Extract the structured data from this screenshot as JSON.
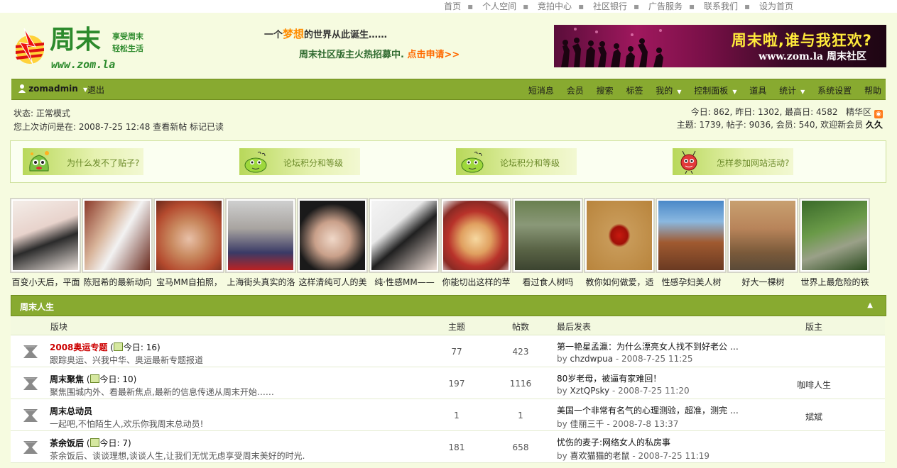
{
  "top_links": [
    "首页",
    "个人空间",
    "竞拍中心",
    "社区银行",
    "广告服务",
    "联系我们",
    "设为首页"
  ],
  "logo": {
    "brand": "周末",
    "tag1": "享受周末",
    "tag2": "轻松生活",
    "url": "www.zom.la"
  },
  "slogan": {
    "line1_pre": "一个",
    "line1_em": "梦想",
    "line1_post": "的世界从此诞生……",
    "line2": "周末社区版主火热招募中.",
    "line2_link": "点击申请>>"
  },
  "banner": {
    "title": "周末啦,谁与我狂欢?",
    "subtitle": "www.zom.la 周末社区"
  },
  "nav": {
    "user": "zomadmin",
    "logout": "退出",
    "items": [
      "短消息",
      "会员",
      "搜索",
      "标签",
      "我的",
      "控制面板",
      "道具",
      "统计",
      "系统设置",
      "帮助"
    ]
  },
  "status": {
    "mode_label": "状态:",
    "mode": "正常模式",
    "last_visit": "您上次访问是在: 2008-7-25 12:48",
    "view_new": "查看新帖",
    "mark_read": "标记已读"
  },
  "stats": {
    "line1": "今日: 862, 昨日: 1302, 最高日: 4582",
    "digest": "精华区",
    "line2": "主题: 1739, 帖子: 9036, 会员: 540, 欢迎新会员",
    "newest": "久久"
  },
  "tips": [
    "为什么发不了贴子?",
    "论坛积分和等级",
    "论坛积分和等级",
    "怎样参加网站活动?"
  ],
  "photos": [
    {
      "caption": "百变小天后，平面"
    },
    {
      "caption": "陈冠希的最新动向"
    },
    {
      "caption": "宝马MM自拍照，"
    },
    {
      "caption": "上海街头真实的洛"
    },
    {
      "caption": "这样清纯可人的美"
    },
    {
      "caption": "纯·性感MM——"
    },
    {
      "caption": "你能切出这样的苹"
    },
    {
      "caption": "看过食人树吗"
    },
    {
      "caption": "教你如何做爱，适"
    },
    {
      "caption": "性感孕妇美人树"
    },
    {
      "caption": "好大一棵树"
    },
    {
      "caption": "世界上最危险的铁"
    }
  ],
  "category": {
    "title": "周末人生",
    "collapse": "▲"
  },
  "columns": {
    "forum": "版块",
    "topics": "主题",
    "posts": "帖数",
    "last": "最后发表",
    "moderator": "版主"
  },
  "forums": [
    {
      "name": "2008奥运专题",
      "today": "今日: 16",
      "desc": "跟踪奥运、兴我中华、奥运最新专题报道",
      "topics": "77",
      "posts": "423",
      "last_title": "第一艳星孟瀛：为什么漂亮女人找不到好老公 …",
      "by": "by",
      "last_author": "chzdwpua",
      "last_time": "- 2008-7-25 11:25",
      "moderator": ""
    },
    {
      "name": "周末聚焦",
      "today": "今日: 10",
      "desc": "聚焦围城内外、看最新焦点,最新的信息传递从周末开始……",
      "topics": "197",
      "posts": "1116",
      "last_title": "80岁老母，被逼有家难回！",
      "by": "by",
      "last_author": "XztQPsky",
      "last_time": "- 2008-7-25 11:20",
      "moderator": "咖啡人生"
    },
    {
      "name": "周末总动员",
      "today": "",
      "desc": "一起吧,不怕陌生人,欢乐你我周末总动员!",
      "topics": "1",
      "posts": "1",
      "last_title": "美国一个非常有名气的心理测验，超准，测完 …",
      "by": "by",
      "last_author": "佳丽三千",
      "last_time": "- 2008-7-8 13:37",
      "moderator": "斌斌"
    },
    {
      "name": "茶余饭后",
      "today": "今日: 7",
      "desc": "茶余饭后、谈谈理想,谈谈人生,让我们无忧无虑享受周末美好的时光.",
      "topics": "181",
      "posts": "658",
      "last_title": "忧伤的麦子:网络女人的私房事",
      "by": "by",
      "last_author": "喜欢猫猫的老鼠",
      "last_time": "- 2008-7-25 11:19",
      "moderator": ""
    }
  ]
}
